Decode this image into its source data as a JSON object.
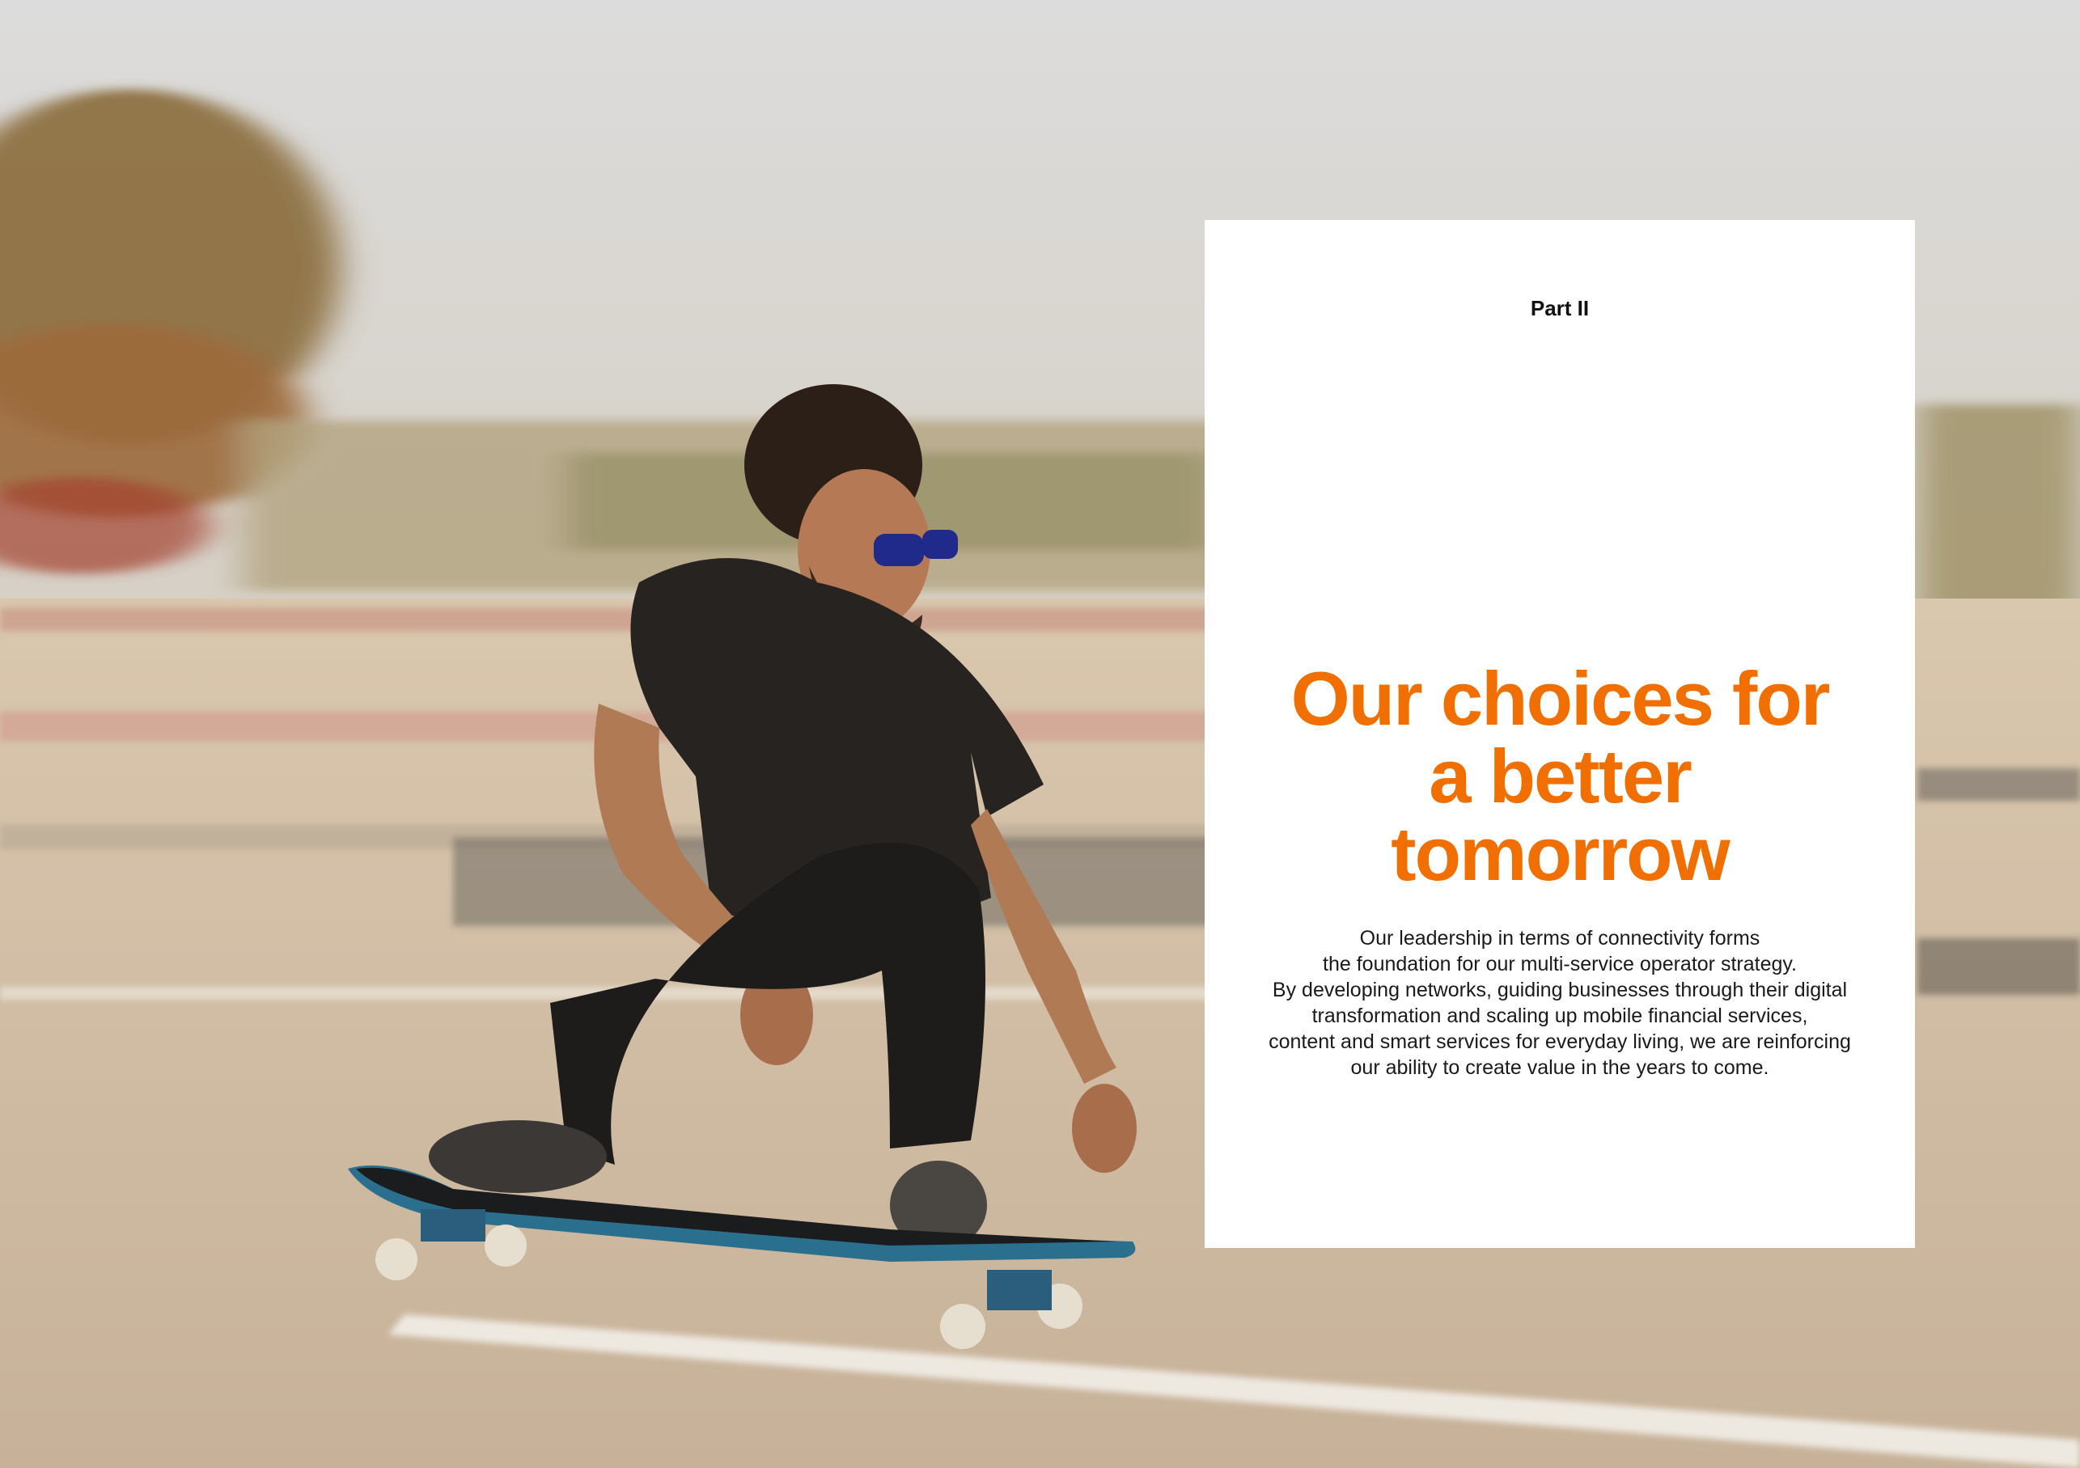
{
  "card": {
    "part_label": "Part II",
    "headline_lines": [
      "Our choices for",
      "a better",
      "tomorrow"
    ],
    "body_lines": [
      "Our leadership in terms of connectivity forms",
      "the foundation for our multi-service operator strategy.",
      "By developing networks, guiding businesses through their digital",
      "transformation and scaling up mobile financial services,",
      "content and smart services for everyday living, we are reinforcing",
      "our ability to create value in the years to come."
    ]
  },
  "colors": {
    "accent": "#f16e00",
    "card_background": "#ffffff",
    "body_text": "#1a1a1a"
  }
}
